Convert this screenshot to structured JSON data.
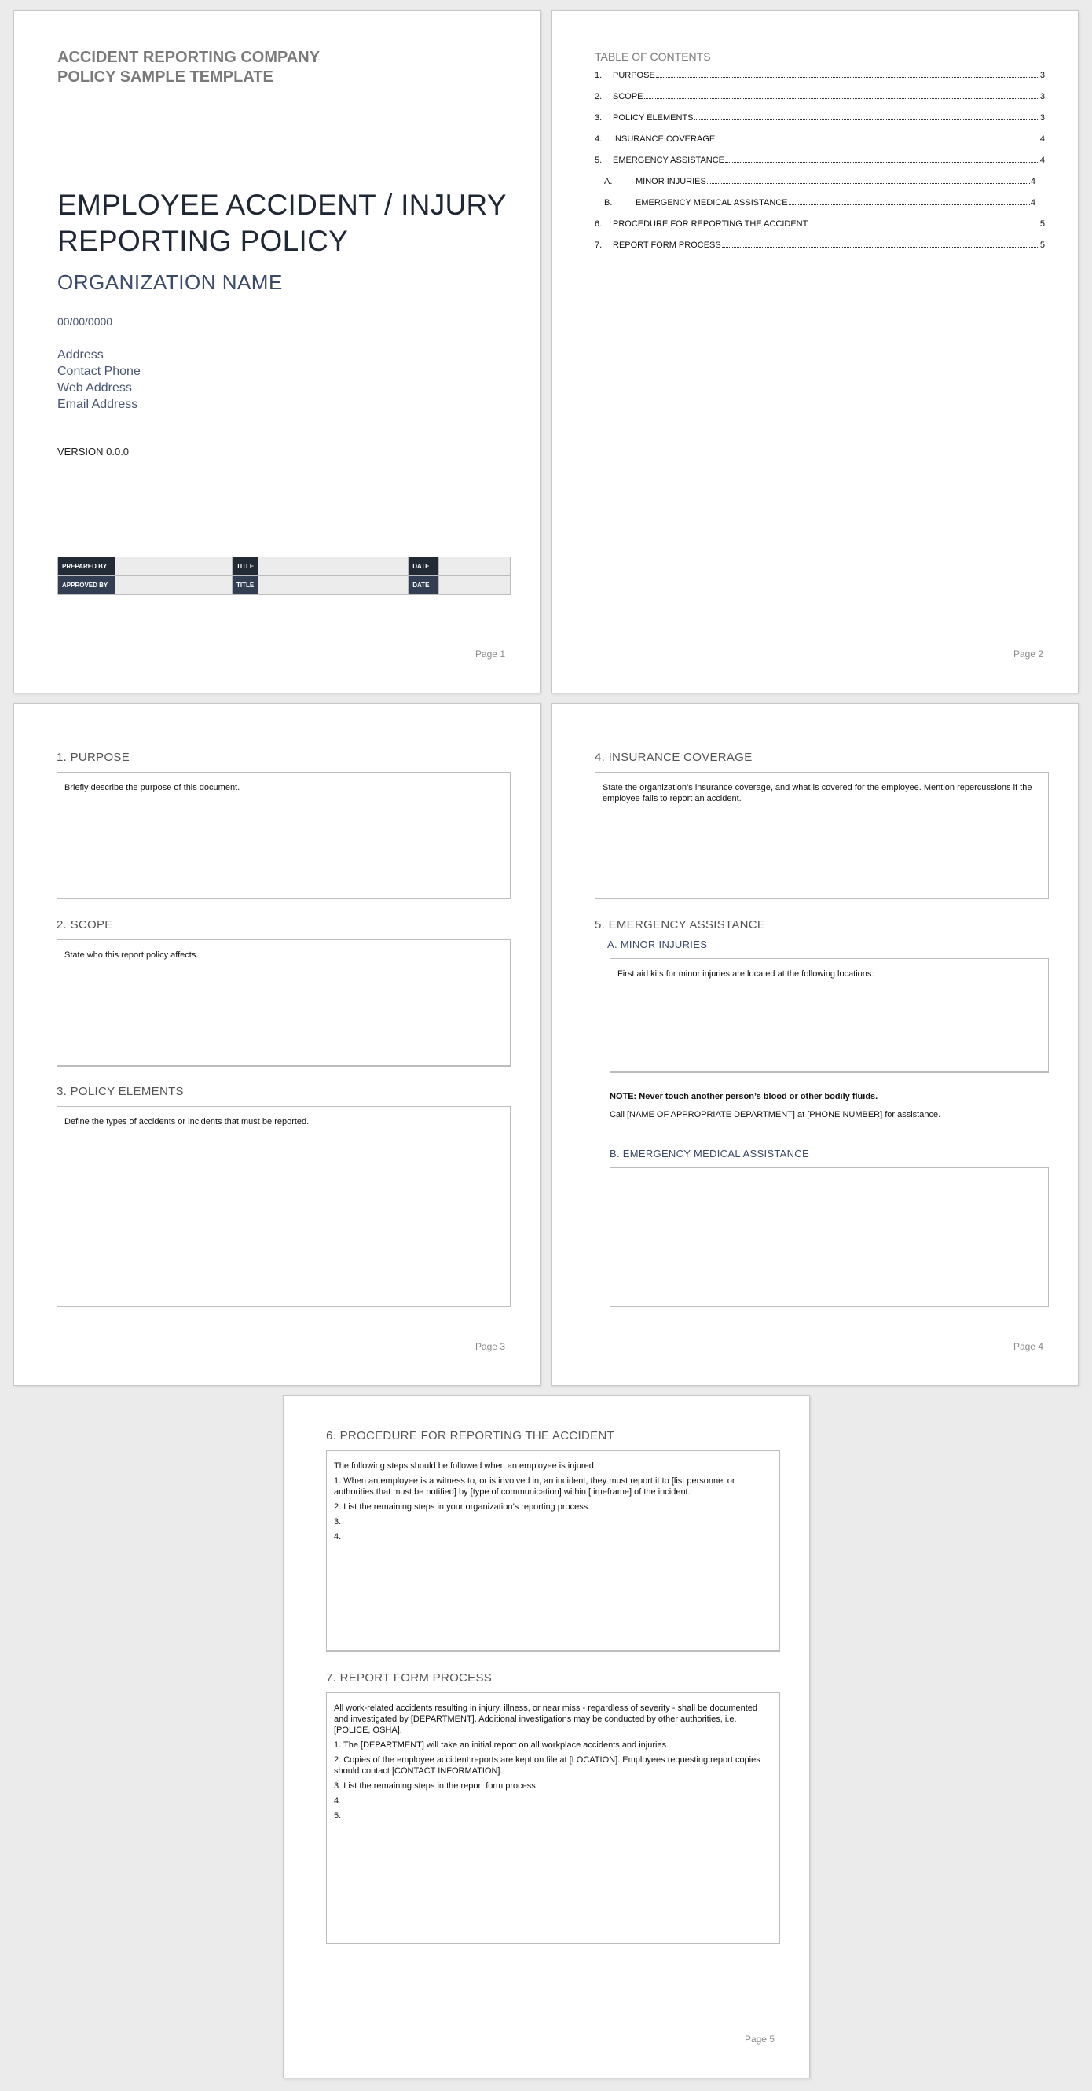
{
  "page1": {
    "top_title_line1": "ACCIDENT REPORTING COMPANY",
    "top_title_line2": "POLICY SAMPLE TEMPLATE",
    "main_title_line1": "EMPLOYEE ACCIDENT / INJURY",
    "main_title_line2": "REPORTING POLICY",
    "org_name": "ORGANIZATION NAME",
    "date": "00/00/0000",
    "contact": [
      "Address",
      "Contact Phone",
      "Web Address",
      "Email Address"
    ],
    "version": "VERSION 0.0.0",
    "signature_table": [
      {
        "label": "PREPARED BY",
        "value": "",
        "title_label": "TITLE",
        "title_value": "",
        "date_label": "DATE",
        "date_value": ""
      },
      {
        "label": "APPROVED BY",
        "value": "",
        "title_label": "TITLE",
        "title_value": "",
        "date_label": "DATE",
        "date_value": ""
      }
    ],
    "page_label": "Page 1"
  },
  "page2": {
    "toc_title": "TABLE OF CONTENTS",
    "toc": [
      {
        "num": "1.",
        "label": "PURPOSE",
        "page": "3"
      },
      {
        "num": "2.",
        "label": "SCOPE",
        "page": "3"
      },
      {
        "num": "3.",
        "label": "POLICY ELEMENTS",
        "page": "3"
      },
      {
        "num": "4.",
        "label": "INSURANCE COVERAGE",
        "page": "4"
      },
      {
        "num": "5.",
        "label": "EMERGENCY ASSISTANCE",
        "page": "4"
      },
      {
        "num": "A.",
        "label": "MINOR INJURIES",
        "page": "4",
        "sub": true
      },
      {
        "num": "B.",
        "label": "EMERGENCY MEDICAL ASSISTANCE",
        "page": "4",
        "sub": true
      },
      {
        "num": "6.",
        "label": "PROCEDURE FOR REPORTING THE ACCIDENT",
        "page": "5"
      },
      {
        "num": "7.",
        "label": "REPORT FORM PROCESS",
        "page": "5"
      }
    ],
    "page_label": "Page 2"
  },
  "page3": {
    "purpose": {
      "heading": "1.  PURPOSE",
      "text": "Briefly describe the purpose of this document."
    },
    "scope": {
      "heading": "2.  SCOPE",
      "text": "State who this report policy affects."
    },
    "policy_elements": {
      "heading": "3.  POLICY ELEMENTS",
      "text": "Define the types of accidents or incidents that must be reported."
    },
    "page_label": "Page 3"
  },
  "page4": {
    "insurance": {
      "heading": "4.  INSURANCE COVERAGE",
      "text": "State the organization’s insurance coverage, and what is covered for the employee.  Mention repercussions if the employee fails to report an accident."
    },
    "emergency": {
      "heading": "5.  EMERGENCY ASSISTANCE"
    },
    "minor": {
      "heading": "A.  MINOR INJURIES",
      "text": "First aid kits for minor injuries are located at the following locations:"
    },
    "note": "NOTE: Never touch another person’s blood or other bodily fluids.",
    "call": "Call [NAME OF APPROPRIATE DEPARTMENT] at [PHONE NUMBER] for assistance.",
    "medical": {
      "heading": "B.  EMERGENCY MEDICAL ASSISTANCE",
      "text": ""
    },
    "page_label": "Page 4"
  },
  "page5": {
    "procedure": {
      "heading": "6.  PROCEDURE FOR REPORTING THE ACCIDENT",
      "lines": [
        "The following steps should be followed when an employee is injured:",
        "1.  When an employee is a witness to, or is involved in, an incident, they must report it to [list personnel or authorities that must be notified] by [type of communication] within [timeframe] of the incident.",
        "2.  List the remaining steps in your organization’s reporting process.",
        "3.",
        "4."
      ]
    },
    "report_form": {
      "heading": "7.  REPORT FORM PROCESS",
      "lines": [
        "All work-related accidents resulting in injury, illness, or near miss - regardless of severity - shall be documented and investigated by [DEPARTMENT].  Additional investigations may be conducted by other authorities, i.e. [POLICE, OSHA].",
        "1.  The [DEPARTMENT] will take an initial report on all workplace accidents and injuries.",
        "2.  Copies of the employee accident reports are kept on file at [LOCATION].  Employees requesting report copies should contact [CONTACT INFORMATION].",
        "3.  List the remaining steps in the report form process.",
        "4.",
        "5."
      ]
    },
    "page_label": "Page 5"
  }
}
